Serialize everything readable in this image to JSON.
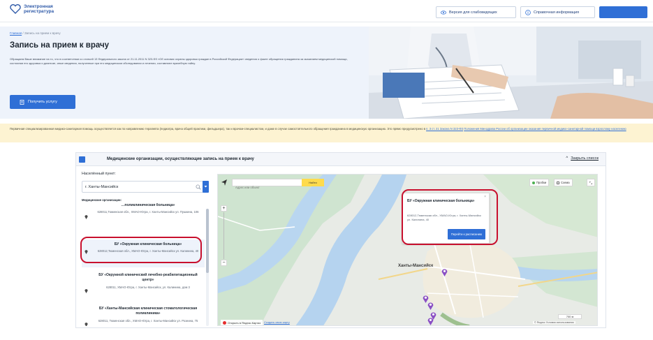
{
  "header": {
    "logo_line1": "Электронная",
    "logo_line2": "регистратура",
    "vision_label": "Версия для слабовидящих",
    "info_label": "Справочная информация",
    "login_label": ""
  },
  "hero": {
    "breadcrumb_home": "Главная",
    "breadcrumb_sep": "/",
    "breadcrumb_current": "Запись на прием к врачу",
    "title": "Запись на прием к врачу",
    "description": "Обращаем Ваше внимание на то, что в соответствии со статьей 13 Федерального закона от 21.11.2011 N 323-ФЗ «Об основах охраны здоровья граждан в Российской Федерации» сведения о факте обращения гражданина за оказанием медицинской помощи, состоянии его здоровья и диагнозе, иные сведения, полученные при его медицинском обследовании и лечении, составляют врачебную тайну.",
    "get_service_label": "Получить услугу"
  },
  "notice": {
    "text": "Первичная специализированная медико-санитарная помощь осуществляется как по направлению терапевта (педиатра, врача общей практики, фельдшера), так и врачом-специалистом, и даже в случае самостоятельного обращения гражданина в медицинскую организацию. Это прямо предусмотрено в ",
    "link1": "п. 3 ст. 21 Закона N 323-ФЗ",
    "link2": "Положения Минздрава России об организации оказания первичной медико-санитарной помощи взрослому населению"
  },
  "panel": {
    "title": "Медицинские организации, осуществляющие запись на прием к врачу",
    "close_label": "Закрыть список",
    "city_label": "Населённый пункт:",
    "city_value": "г. Ханты-Мансийск",
    "list_label": "Медицинские организации:",
    "organizations": [
      {
        "name": "…поликлиническая больница»",
        "address": "628011,Тюменская обл., ХМАО-Югра, г. Ханты-Мансийск ул. Пушкина, 106"
      },
      {
        "name": "БУ «Окружная клиническая больница»",
        "address": "628012,Тюменская обл., ХМАО-Югра, г. Ханты-Мансийск ул. Калинина, 40"
      },
      {
        "name": "БУ «Окружной клинический лечебно-реабилитационный центр»",
        "address": "628011, ХМАО-Югра, г. Ханты-Мансийск, ул. Калинина, дом 3"
      },
      {
        "name": "БУ «Ханты-Мансийская клиническая стоматологическая поликлиника»",
        "address": "628011, Тюменская обл., ХМАО-Югра, г. Ханты-Мансийск ул. Рознина, 75"
      }
    ]
  },
  "map": {
    "search_placeholder": "Адрес или объект",
    "find_label": "Найти",
    "traffic_label": "Пробки",
    "layers_label": "Схема",
    "city_label": "Ханты-Мансийск",
    "popup": {
      "name": "БУ «Окружная клиническая больница»",
      "address": "628012,Тюменская обл., ХМАО-Югра, г. Ханты-Мансийск ул. Калинина, 40",
      "button_label": "Перейти к расписанию"
    },
    "open_yandex_label": "Открыть в Яндекс.Картах",
    "create_map_label": "Создать свою карту",
    "scale_label": "700 м",
    "terms_label": "© Яндекс Условия использования"
  },
  "colors": {
    "accent": "#2f6fd6",
    "highlight": "#c8102e",
    "notice_bg": "#fdf3d2"
  }
}
